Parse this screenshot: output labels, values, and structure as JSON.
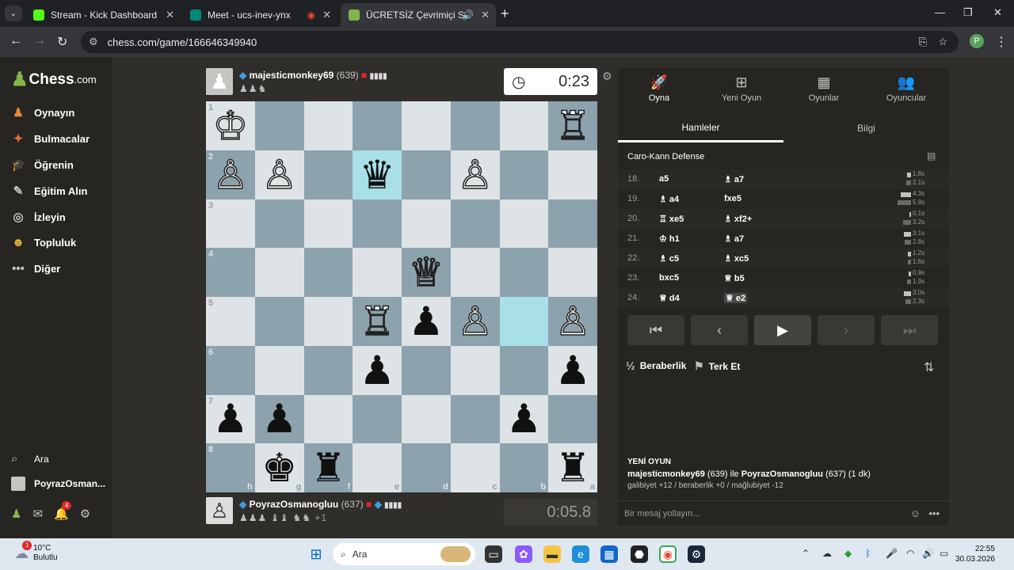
{
  "browser": {
    "tabs": [
      {
        "title": "Stream - Kick Dashboard",
        "color": "#53fc18"
      },
      {
        "title": "Meet - ucs-inev-ynx",
        "color": "#00897b"
      },
      {
        "title": "ÜCRETSİZ Çevrimiçi Satranç",
        "color": "#81b64c"
      }
    ],
    "url": "chess.com/game/166646349940",
    "profile_initial": "P"
  },
  "sidebar": {
    "logo_main": "Chess",
    "logo_suffix": ".com",
    "items": [
      {
        "label": "Oynayın",
        "icon": "play-icon"
      },
      {
        "label": "Bulmacalar",
        "icon": "puzzle-icon"
      },
      {
        "label": "Öğrenin",
        "icon": "learn-icon"
      },
      {
        "label": "Eğitim Alın",
        "icon": "coach-icon"
      },
      {
        "label": "İzleyin",
        "icon": "watch-icon"
      },
      {
        "label": "Topluluk",
        "icon": "community-icon"
      },
      {
        "label": "Diğer",
        "icon": "more-icon"
      }
    ],
    "search_label": "Ara",
    "user_label": "PoyrazOsman...",
    "notification_count": "4"
  },
  "top_player": {
    "name": "majesticmonkey69",
    "rating": "(639)",
    "clock": "0:23",
    "captured": "♟♟♞"
  },
  "bottom_player": {
    "name": "PoyrazOsmanogluu",
    "rating": "(637)",
    "clock": "0:05.8",
    "captured": "♟♟♟ ♝♝ ♞♞",
    "material": "+1"
  },
  "board": {
    "highlight_colors": {
      "light": "#dee3e6",
      "dark": "#8ca2ad",
      "highlight": "#a9dfe7"
    },
    "rank_labels": [
      "1",
      "2",
      "3",
      "4",
      "5",
      "6",
      "7",
      "8"
    ],
    "file_labels": [
      "h",
      "g",
      "f",
      "e",
      "d",
      "c",
      "b",
      "a"
    ],
    "pieces": [
      {
        "r": 0,
        "c": 0,
        "p": "♔",
        "s": "w"
      },
      {
        "r": 0,
        "c": 7,
        "p": "♖",
        "s": "w"
      },
      {
        "r": 1,
        "c": 0,
        "p": "♙",
        "s": "w"
      },
      {
        "r": 1,
        "c": 1,
        "p": "♙",
        "s": "w"
      },
      {
        "r": 1,
        "c": 3,
        "p": "♛",
        "s": "b"
      },
      {
        "r": 1,
        "c": 5,
        "p": "♙",
        "s": "w"
      },
      {
        "r": 3,
        "c": 4,
        "p": "♕",
        "s": "w"
      },
      {
        "r": 4,
        "c": 3,
        "p": "♖",
        "s": "w"
      },
      {
        "r": 4,
        "c": 4,
        "p": "♟",
        "s": "b"
      },
      {
        "r": 4,
        "c": 5,
        "p": "♙",
        "s": "w"
      },
      {
        "r": 4,
        "c": 7,
        "p": "♙",
        "s": "w"
      },
      {
        "r": 5,
        "c": 3,
        "p": "♟",
        "s": "b"
      },
      {
        "r": 5,
        "c": 7,
        "p": "♟",
        "s": "b"
      },
      {
        "r": 6,
        "c": 0,
        "p": "♟",
        "s": "b"
      },
      {
        "r": 6,
        "c": 1,
        "p": "♟",
        "s": "b"
      },
      {
        "r": 6,
        "c": 6,
        "p": "♟",
        "s": "b"
      },
      {
        "r": 7,
        "c": 1,
        "p": "♚",
        "s": "b"
      },
      {
        "r": 7,
        "c": 2,
        "p": "♜",
        "s": "b"
      },
      {
        "r": 7,
        "c": 7,
        "p": "♜",
        "s": "b"
      }
    ],
    "highlights": [
      {
        "r": 1,
        "c": 3
      },
      {
        "r": 4,
        "c": 6
      }
    ]
  },
  "panel": {
    "tabs": [
      {
        "label": "Oyna",
        "icon": "rocket-icon"
      },
      {
        "label": "Yeni Oyun",
        "icon": "plus-icon"
      },
      {
        "label": "Oyunlar",
        "icon": "board-icon"
      },
      {
        "label": "Oyuncular",
        "icon": "players-icon"
      }
    ],
    "subtabs": [
      "Hamleler",
      "Bilgi"
    ],
    "opening": "Caro-Kann Defense",
    "moves": [
      {
        "n": "18.",
        "w": "a5",
        "b": "♗ a7",
        "tw": "1.8s",
        "tb": "2.1s",
        "bw": 0.3,
        "bb": 0.35
      },
      {
        "n": "19.",
        "w": "♗ a4",
        "b": "fxe5",
        "tw": "4.3s",
        "tb": "5.9s",
        "bw": 0.7,
        "bb": 0.95
      },
      {
        "n": "20.",
        "w": "♖ xe5",
        "b": "♗ xf2+",
        "tw": "0.1s",
        "tb": "3.2s",
        "bw": 0.05,
        "bb": 0.55
      },
      {
        "n": "21.",
        "w": "♔ h1",
        "b": "♗ a7",
        "tw": "3.1s",
        "tb": "2.8s",
        "bw": 0.5,
        "bb": 0.45
      },
      {
        "n": "22.",
        "w": "♗ c5",
        "b": "♗ xc5",
        "tw": "1.2s",
        "tb": "1.6s",
        "bw": 0.2,
        "bb": 0.25
      },
      {
        "n": "23.",
        "w": "bxc5",
        "b": "♕ b5",
        "tw": "0.9s",
        "tb": "1.9s",
        "bw": 0.15,
        "bb": 0.3
      },
      {
        "n": "24.",
        "w": "♕ d4",
        "b": "♕ e2",
        "tw": "3.0s",
        "tb": "2.3s",
        "bw": 0.5,
        "bb": 0.4
      }
    ],
    "draw_label": "Beraberlik",
    "resign_label": "Terk Et",
    "new_game_heading": "YENİ OYUN",
    "new_game_p1": "majesticmonkey69",
    "new_game_p1_rating": "(639)",
    "new_game_mid": "ile",
    "new_game_p2": "PoyrazOsmanogluu",
    "new_game_p2_rating": "(637)",
    "new_game_time": "(1 dk)",
    "stats": "galibiyet +12 / beraberlik +0 / mağlubiyet -12",
    "chat_placeholder": "Bir mesaj yollayın..."
  },
  "taskbar": {
    "weather_temp": "10°C",
    "weather_desc": "Bulutlu",
    "weather_badge": "1",
    "search": "Ara",
    "time": "22:55",
    "date": "30.03.2026"
  }
}
